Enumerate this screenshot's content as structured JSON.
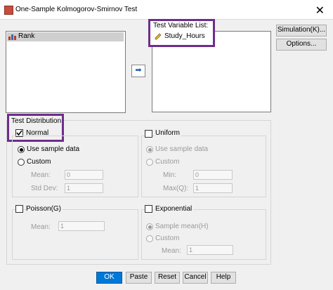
{
  "window": {
    "title": "One-Sample Kolmogorov-Smirnov Test",
    "close": "✕"
  },
  "source_list": {
    "items": [
      {
        "label": "Rank"
      }
    ]
  },
  "arrow_button": {
    "glyph": "➡"
  },
  "target": {
    "label": "Test Variable List:",
    "items": [
      {
        "label": "Study_Hours"
      }
    ]
  },
  "side_buttons": {
    "simulation": "Simulation(K)...",
    "options": "Options..."
  },
  "test_distribution": {
    "label": "Test Distribution",
    "normal": {
      "label": "Normal",
      "checked": true,
      "use_sample": "Use sample data",
      "custom": "Custom",
      "mean_label": "Mean:",
      "mean_value": "0",
      "stddev_label": "Std Dev:",
      "stddev_value": "1"
    },
    "uniform": {
      "label": "Uniform",
      "checked": false,
      "use_sample": "Use sample data",
      "custom": "Custom",
      "min_label": "Min:",
      "min_value": "0",
      "max_label": "Max(Q):",
      "max_value": "1"
    },
    "poisson": {
      "label": "Poisson(G)",
      "checked": false,
      "mean_label": "Mean:",
      "mean_value": "1"
    },
    "exponential": {
      "label": "Exponential",
      "checked": false,
      "sample_mean": "Sample mean(H)",
      "custom": "Custom",
      "mean_label": "Mean:",
      "mean_value": "1"
    }
  },
  "footer": {
    "ok": "OK",
    "paste": "Paste",
    "reset": "Reset",
    "cancel": "Cancel",
    "help": "Help"
  },
  "colors": {
    "highlight": "#6e2d8c",
    "primary": "#0078d7"
  }
}
